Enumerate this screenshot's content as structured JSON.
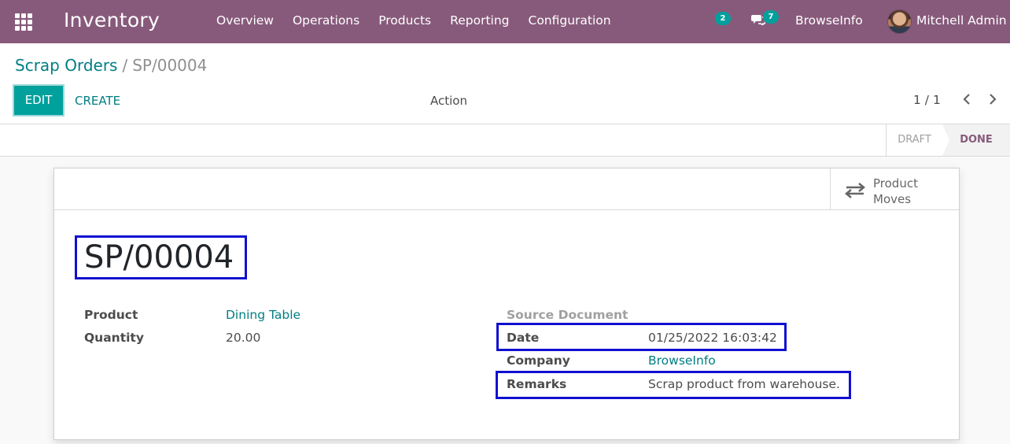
{
  "navbar": {
    "app_name": "Inventory",
    "menu": [
      "Overview",
      "Operations",
      "Products",
      "Reporting",
      "Configuration"
    ],
    "activity_count": "2",
    "messages_count": "7",
    "company": "BrowseInfo",
    "user": "Mitchell Admin",
    "bg_color": "#875a7b"
  },
  "breadcrumb": {
    "parent": "Scrap Orders",
    "separator": "/",
    "current": "SP/00004"
  },
  "toolbar": {
    "edit_label": "EDIT",
    "create_label": "CREATE",
    "action_label": "Action",
    "pager": "1 / 1"
  },
  "status": {
    "stages": [
      "DRAFT",
      "DONE"
    ],
    "active": "DONE"
  },
  "smart_button": {
    "label_line1": "Product",
    "label_line2": "Moves",
    "icon": "exchange-arrows-icon"
  },
  "record": {
    "name": "SP/00004",
    "fields_left": [
      {
        "label": "Product",
        "value": "Dining Table"
      },
      {
        "label": "Quantity",
        "value": "20.00"
      }
    ],
    "source_document_label": "Source Document",
    "date_label": "Date",
    "date_value": "01/25/2022 16:03:42",
    "company_label": "Company",
    "company_value": "BrowseInfo",
    "remarks_label": "Remarks",
    "remarks_value": "Scrap product from warehouse."
  },
  "colors": {
    "accent": "#00a09d",
    "link": "#017e84",
    "highlight_box": "#1010d0"
  }
}
